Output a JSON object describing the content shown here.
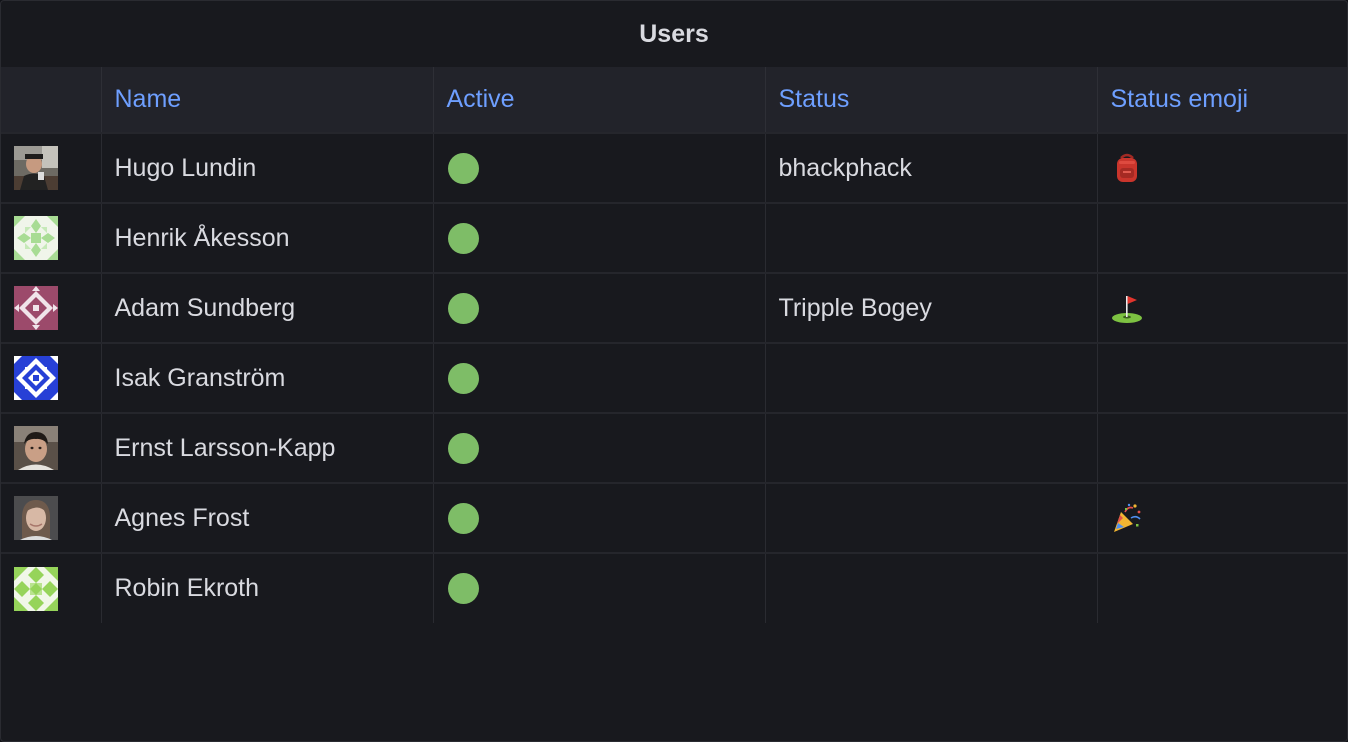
{
  "panel": {
    "title": "Users"
  },
  "columns": [
    "",
    "Name",
    "Active",
    "Status",
    "Status emoji"
  ],
  "rows": [
    {
      "avatar": "photo-avatar",
      "name": "Hugo Lundin",
      "active": true,
      "status": "bhackphack",
      "emoji_icon": "backpack-icon"
    },
    {
      "avatar": "identicon-light-green",
      "name": "Henrik Åkesson",
      "active": true,
      "status": "",
      "emoji_icon": ""
    },
    {
      "avatar": "identicon-mauve",
      "name": "Adam Sundberg",
      "active": true,
      "status": "Tripple Bogey",
      "emoji_icon": "golf-flag-icon"
    },
    {
      "avatar": "identicon-blue",
      "name": "Isak Granström",
      "active": true,
      "status": "",
      "emoji_icon": ""
    },
    {
      "avatar": "photo-avatar",
      "name": "Ernst Larsson-Kapp",
      "active": true,
      "status": "",
      "emoji_icon": ""
    },
    {
      "avatar": "photo-avatar",
      "name": "Agnes Frost",
      "active": true,
      "status": "",
      "emoji_icon": "party-popper-icon"
    },
    {
      "avatar": "identicon-green",
      "name": "Robin Ekroth",
      "active": true,
      "status": "",
      "emoji_icon": ""
    }
  ],
  "colors": {
    "background": "#18191e",
    "header_background": "#22232a",
    "header_text": "#6e9fff",
    "active_dot": "#7ebd67",
    "text": "#d9dae0"
  }
}
